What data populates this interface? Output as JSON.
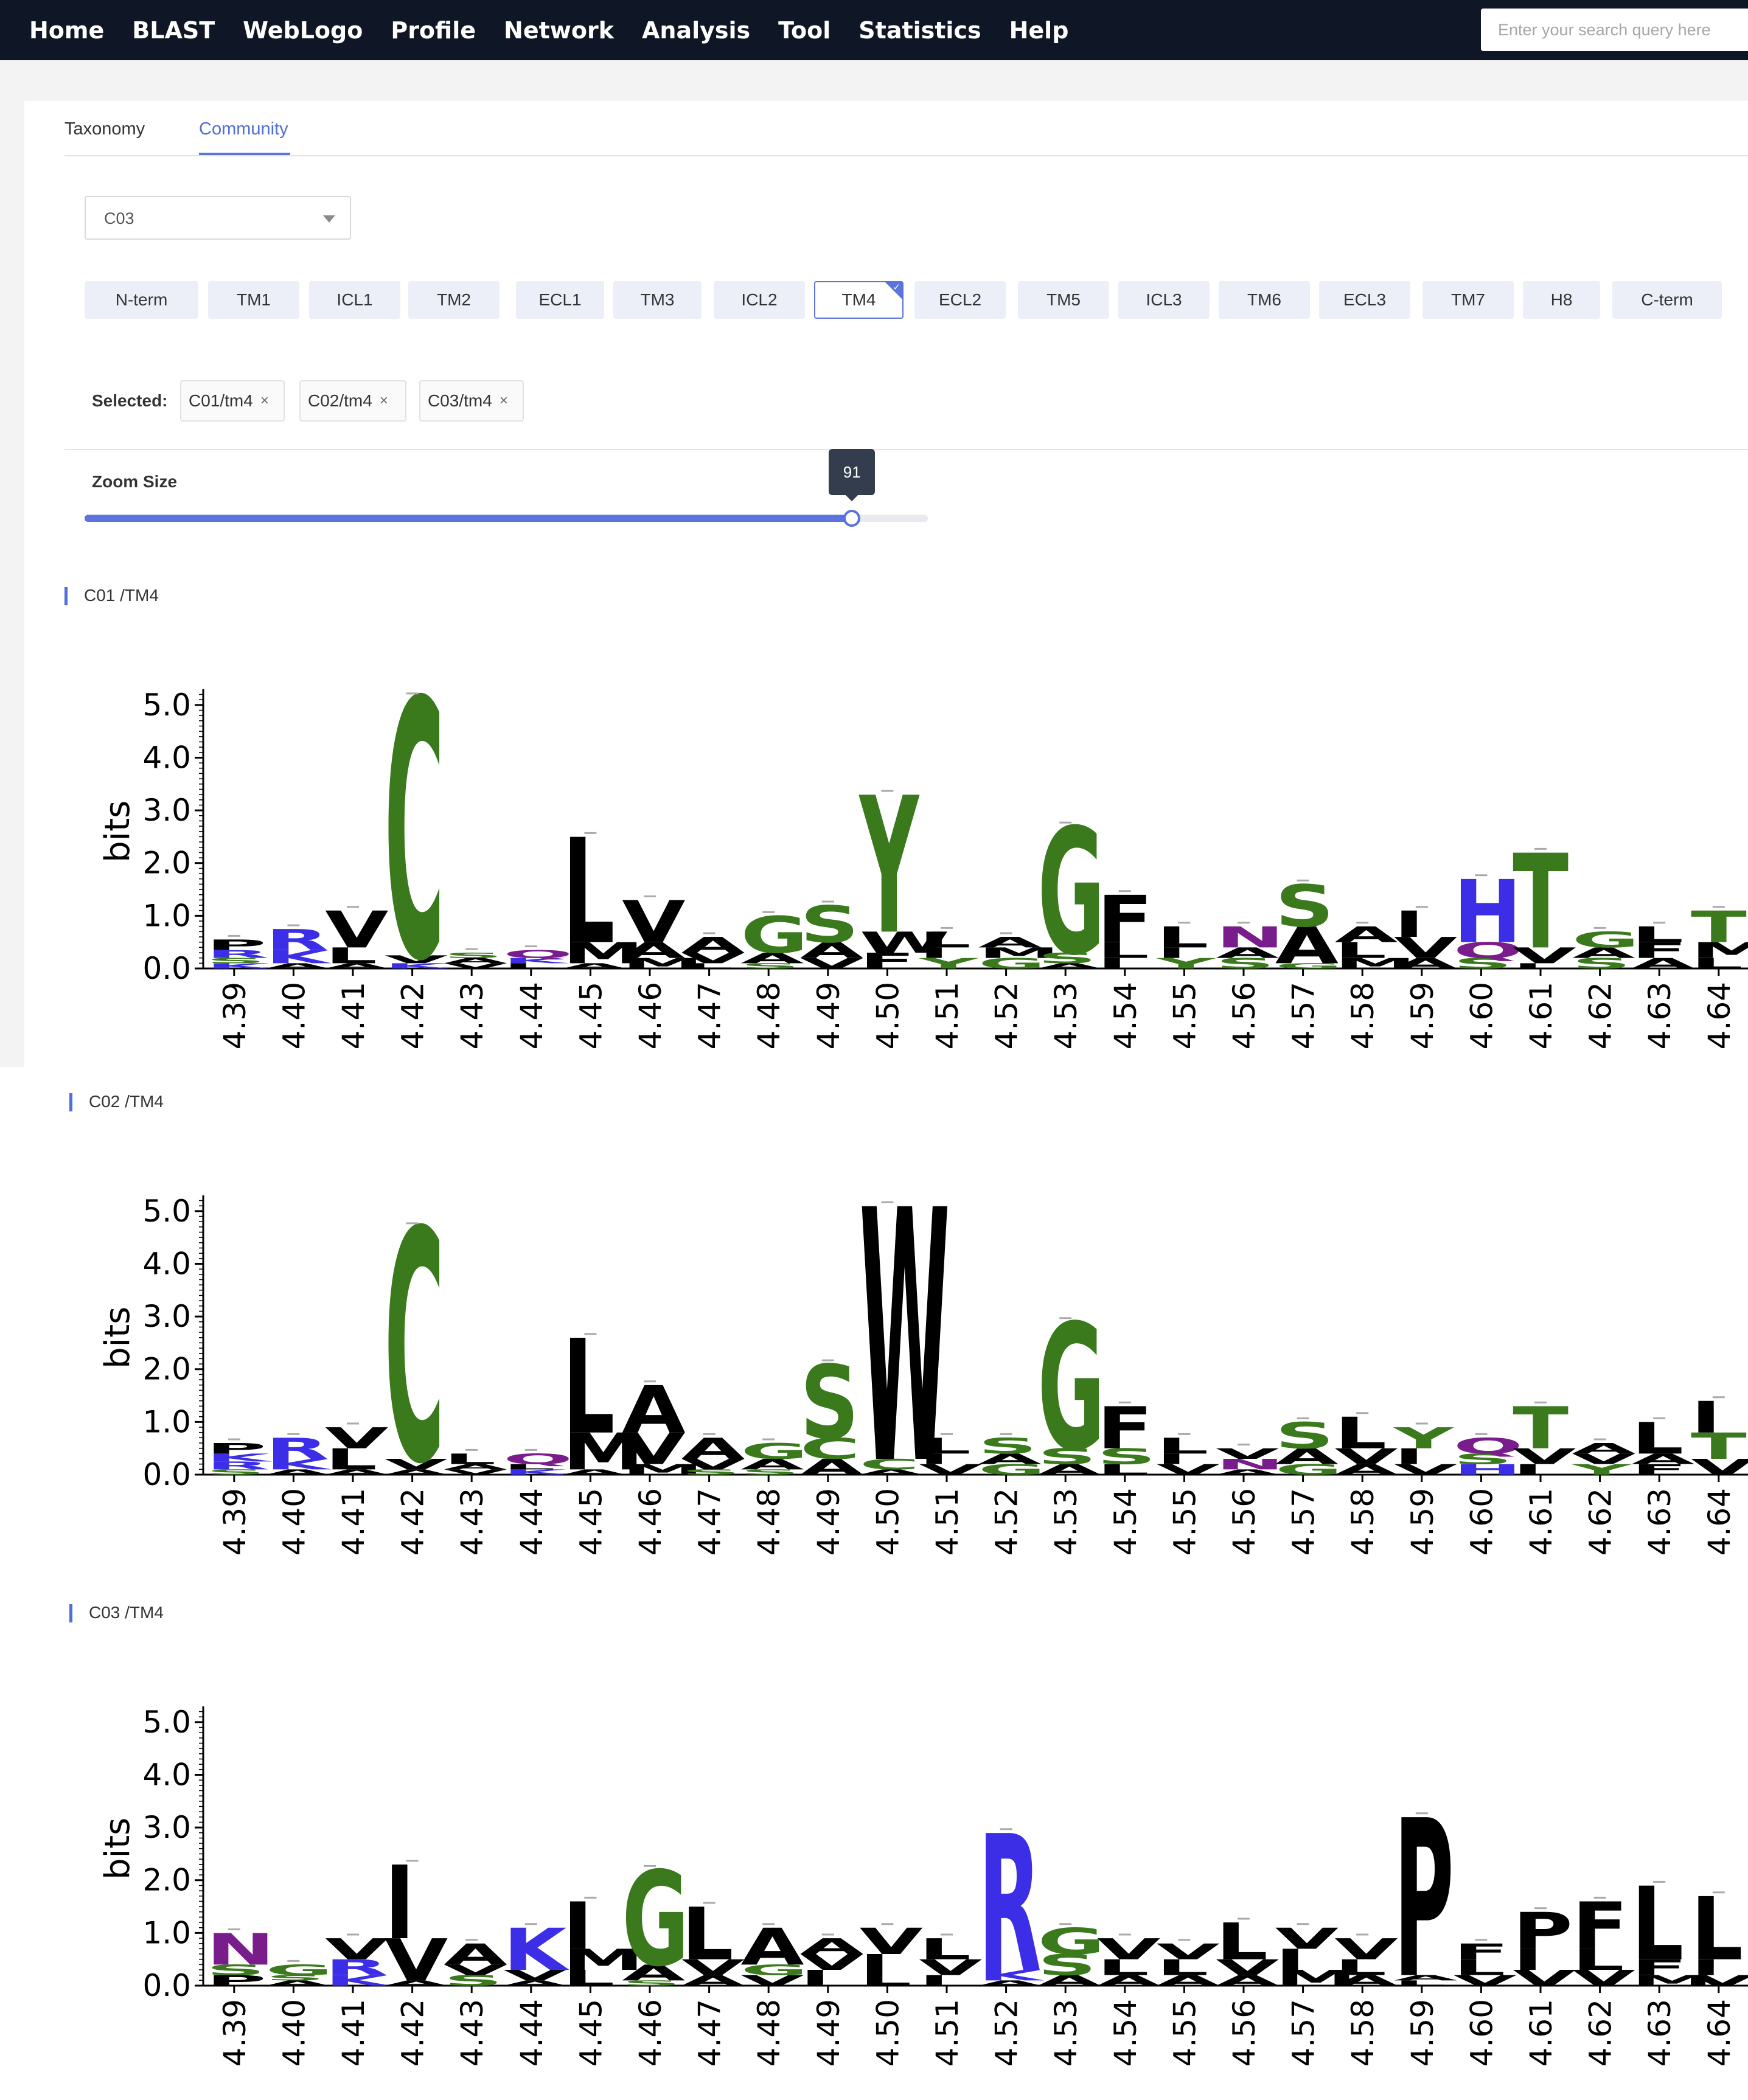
{
  "nav": {
    "items": [
      "Home",
      "BLAST",
      "WebLogo",
      "Profile",
      "Network",
      "Analysis",
      "Tool",
      "Statistics",
      "Help"
    ],
    "search_placeholder": "Enter your search query here"
  },
  "tabs": {
    "taxonomy": "Taxonomy",
    "community": "Community",
    "active": "Community"
  },
  "select": {
    "value": "C03"
  },
  "segments": {
    "items": [
      "N-term",
      "TM1",
      "ICL1",
      "TM2",
      "ECL1",
      "TM3",
      "ICL2",
      "TM4",
      "ECL2",
      "TM5",
      "ICL3",
      "TM6",
      "ECL3",
      "TM7",
      "H8",
      "C-term"
    ],
    "active": "TM4"
  },
  "selected": {
    "label": "Selected:",
    "tags": [
      "C01/tm4",
      "C02/tm4",
      "C03/tm4"
    ],
    "remove_glyph": "×"
  },
  "zoom": {
    "label": "Zoom Size",
    "value": 91,
    "min": 0,
    "max": 100
  },
  "colors": {
    "nav_bg": "#0f1726",
    "accent": "#5a73dd",
    "hydrophobic": "#000000",
    "polar": "#3a7a1c",
    "basic": "#3b2ee6",
    "acidic": "#e0201b",
    "amide": "#7a1d8c"
  },
  "chart_data": [
    {
      "type": "sequence-logo",
      "title": "C01 /TM4",
      "ylabel": "bits",
      "ylim": [
        0,
        5
      ],
      "yticks": [
        "0.0",
        "1.0",
        "2.0",
        "3.0",
        "4.0",
        "5.0"
      ],
      "positions": [
        "4.39",
        "4.40",
        "4.41",
        "4.42",
        "4.43",
        "4.44",
        "4.45",
        "4.46",
        "4.47",
        "4.48",
        "4.49",
        "4.50",
        "4.51",
        "4.52",
        "4.53",
        "4.54",
        "4.55",
        "4.56",
        "4.57",
        "4.58",
        "4.59",
        "4.60",
        "4.61",
        "4.62",
        "4.63",
        "4.64"
      ],
      "columns": [
        [
          [
            "P",
            0.2
          ],
          [
            "R",
            0.15
          ],
          [
            "K",
            0.1
          ],
          [
            "S",
            0.1
          ]
        ],
        [
          [
            "R",
            0.4
          ],
          [
            "K",
            0.25
          ],
          [
            "A",
            0.1
          ]
        ],
        [
          [
            "V",
            0.7
          ],
          [
            "L",
            0.3
          ],
          [
            "A",
            0.1
          ]
        ],
        [
          [
            "C",
            4.9
          ],
          [
            "V",
            0.15
          ],
          [
            "K",
            0.1
          ]
        ],
        [
          [
            "V",
            0.1
          ],
          [
            "A",
            0.1
          ],
          [
            "S",
            0.1
          ]
        ],
        [
          [
            "Q",
            0.15
          ],
          [
            "L",
            0.1
          ],
          [
            "K",
            0.1
          ]
        ],
        [
          [
            "L",
            2.0
          ],
          [
            "M",
            0.4
          ],
          [
            "A",
            0.1
          ]
        ],
        [
          [
            "V",
            0.8
          ],
          [
            "A",
            0.3
          ],
          [
            "M",
            0.2
          ]
        ],
        [
          [
            "A",
            0.3
          ],
          [
            "V",
            0.2
          ],
          [
            "L",
            0.1
          ]
        ],
        [
          [
            "G",
            0.7
          ],
          [
            "A",
            0.2
          ],
          [
            "S",
            0.1
          ]
        ],
        [
          [
            "S",
            0.7
          ],
          [
            "A",
            0.3
          ],
          [
            "V",
            0.2
          ]
        ],
        [
          [
            "Y",
            2.6
          ],
          [
            "W",
            0.4
          ],
          [
            "F",
            0.3
          ]
        ],
        [
          [
            "L",
            0.3
          ],
          [
            "Y",
            0.2
          ],
          [
            "I",
            0.2
          ]
        ],
        [
          [
            "G",
            0.2
          ],
          [
            "M",
            0.2
          ],
          [
            "A",
            0.2
          ]
        ],
        [
          [
            "G",
            2.4
          ],
          [
            "S",
            0.2
          ],
          [
            "A",
            0.1
          ]
        ],
        [
          [
            "F",
            0.9
          ],
          [
            "L",
            0.3
          ],
          [
            "I",
            0.2
          ]
        ],
        [
          [
            "L",
            0.4
          ],
          [
            "Y",
            0.2
          ],
          [
            "I",
            0.2
          ]
        ],
        [
          [
            "N",
            0.4
          ],
          [
            "S",
            0.2
          ],
          [
            "A",
            0.2
          ]
        ],
        [
          [
            "S",
            0.8
          ],
          [
            "A",
            0.7
          ],
          [
            "G",
            0.1
          ]
        ],
        [
          [
            "L",
            0.3
          ],
          [
            "A",
            0.3
          ],
          [
            "M",
            0.2
          ]
        ],
        [
          [
            "I",
            0.5
          ],
          [
            "V",
            0.4
          ],
          [
            "A",
            0.2
          ]
        ],
        [
          [
            "H",
            1.2
          ],
          [
            "Q",
            0.3
          ],
          [
            "S",
            0.2
          ]
        ],
        [
          [
            "T",
            1.8
          ],
          [
            "V",
            0.3
          ],
          [
            "I",
            0.1
          ]
        ],
        [
          [
            "G",
            0.3
          ],
          [
            "S",
            0.2
          ],
          [
            "A",
            0.2
          ]
        ],
        [
          [
            "F",
            0.3
          ],
          [
            "L",
            0.3
          ],
          [
            "A",
            0.2
          ]
        ],
        [
          [
            "T",
            0.6
          ],
          [
            "M",
            0.3
          ],
          [
            "L",
            0.2
          ]
        ]
      ]
    },
    {
      "type": "sequence-logo",
      "title": "C02 /TM4",
      "ylabel": "bits",
      "ylim": [
        0,
        5
      ],
      "yticks": [
        "0.0",
        "1.0",
        "2.0",
        "3.0",
        "4.0",
        "5.0"
      ],
      "positions": [
        "4.39",
        "4.40",
        "4.41",
        "4.42",
        "4.43",
        "4.44",
        "4.45",
        "4.46",
        "4.47",
        "4.48",
        "4.49",
        "4.50",
        "4.51",
        "4.52",
        "4.53",
        "4.54",
        "4.55",
        "4.56",
        "4.57",
        "4.58",
        "4.59",
        "4.60",
        "4.61",
        "4.62",
        "4.63",
        "4.64"
      ],
      "columns": [
        [
          [
            "P",
            0.2
          ],
          [
            "R",
            0.15
          ],
          [
            "K",
            0.15
          ],
          [
            "S",
            0.1
          ]
        ],
        [
          [
            "R",
            0.4
          ],
          [
            "K",
            0.2
          ],
          [
            "A",
            0.1
          ]
        ],
        [
          [
            "L",
            0.4
          ],
          [
            "V",
            0.4
          ],
          [
            "A",
            0.1
          ]
        ],
        [
          [
            "C",
            4.4
          ],
          [
            "V",
            0.2
          ],
          [
            "A",
            0.1
          ]
        ],
        [
          [
            "L",
            0.2
          ],
          [
            "V",
            0.1
          ],
          [
            "A",
            0.1
          ]
        ],
        [
          [
            "Q",
            0.2
          ],
          [
            "K",
            0.1
          ],
          [
            "L",
            0.1
          ]
        ],
        [
          [
            "L",
            1.8
          ],
          [
            "M",
            0.7
          ],
          [
            "A",
            0.1
          ]
        ],
        [
          [
            "A",
            0.9
          ],
          [
            "V",
            0.6
          ],
          [
            "M",
            0.2
          ]
        ],
        [
          [
            "A",
            0.4
          ],
          [
            "V",
            0.2
          ],
          [
            "S",
            0.1
          ]
        ],
        [
          [
            "G",
            0.3
          ],
          [
            "A",
            0.2
          ],
          [
            "S",
            0.1
          ]
        ],
        [
          [
            "S",
            1.4
          ],
          [
            "C",
            0.4
          ],
          [
            "A",
            0.3
          ]
        ],
        [
          [
            "W",
            4.8
          ],
          [
            "C",
            0.2
          ],
          [
            "A",
            0.1
          ]
        ],
        [
          [
            "L",
            0.3
          ],
          [
            "V",
            0.2
          ],
          [
            "I",
            0.2
          ]
        ],
        [
          [
            "S",
            0.3
          ],
          [
            "G",
            0.2
          ],
          [
            "A",
            0.2
          ]
        ],
        [
          [
            "G",
            2.4
          ],
          [
            "S",
            0.3
          ],
          [
            "A",
            0.2
          ]
        ],
        [
          [
            "F",
            0.8
          ],
          [
            "S",
            0.3
          ],
          [
            "L",
            0.2
          ]
        ],
        [
          [
            "L",
            0.3
          ],
          [
            "V",
            0.2
          ],
          [
            "I",
            0.2
          ]
        ],
        [
          [
            "N",
            0.2
          ],
          [
            "V",
            0.2
          ],
          [
            "A",
            0.1
          ]
        ],
        [
          [
            "S",
            0.5
          ],
          [
            "A",
            0.3
          ],
          [
            "G",
            0.2
          ]
        ],
        [
          [
            "L",
            0.6
          ],
          [
            "V",
            0.3
          ],
          [
            "A",
            0.2
          ]
        ],
        [
          [
            "Y",
            0.4
          ],
          [
            "I",
            0.3
          ],
          [
            "V",
            0.2
          ]
        ],
        [
          [
            "Q",
            0.3
          ],
          [
            "H",
            0.2
          ],
          [
            "S",
            0.2
          ]
        ],
        [
          [
            "T",
            0.8
          ],
          [
            "V",
            0.3
          ],
          [
            "I",
            0.2
          ]
        ],
        [
          [
            "Y",
            0.2
          ],
          [
            "V",
            0.2
          ],
          [
            "A",
            0.2
          ]
        ],
        [
          [
            "L",
            0.6
          ],
          [
            "F",
            0.2
          ],
          [
            "A",
            0.2
          ]
        ],
        [
          [
            "I",
            0.6
          ],
          [
            "T",
            0.5
          ],
          [
            "V",
            0.3
          ]
        ]
      ]
    },
    {
      "type": "sequence-logo",
      "title": "C03 /TM4",
      "ylabel": "bits",
      "ylim": [
        0,
        5
      ],
      "yticks": [
        "0.0",
        "1.0",
        "2.0",
        "3.0",
        "4.0",
        "5.0"
      ],
      "positions": [
        "4.39",
        "4.40",
        "4.41",
        "4.42",
        "4.43",
        "4.44",
        "4.45",
        "4.46",
        "4.47",
        "4.48",
        "4.49",
        "4.50",
        "4.51",
        "4.52",
        "4.53",
        "4.54",
        "4.55",
        "4.56",
        "4.57",
        "4.58",
        "4.59",
        "4.60",
        "4.61",
        "4.62",
        "4.63",
        "4.64"
      ],
      "columns": [
        [
          [
            "N",
            0.6
          ],
          [
            "P",
            0.2
          ],
          [
            "S",
            0.2
          ]
        ],
        [
          [
            "G",
            0.2
          ],
          [
            "A",
            0.1
          ],
          [
            "S",
            0.1
          ]
        ],
        [
          [
            "V",
            0.4
          ],
          [
            "R",
            0.3
          ],
          [
            "K",
            0.2
          ]
        ],
        [
          [
            "I",
            1.4
          ],
          [
            "V",
            0.8
          ],
          [
            "A",
            0.1
          ]
        ],
        [
          [
            "A",
            0.4
          ],
          [
            "S",
            0.2
          ],
          [
            "V",
            0.2
          ]
        ],
        [
          [
            "K",
            0.8
          ],
          [
            "V",
            0.2
          ],
          [
            "A",
            0.1
          ]
        ],
        [
          [
            "I",
            0.9
          ],
          [
            "M",
            0.4
          ],
          [
            "L",
            0.3
          ]
        ],
        [
          [
            "G",
            1.8
          ],
          [
            "A",
            0.3
          ],
          [
            "S",
            0.1
          ]
        ],
        [
          [
            "L",
            1.0
          ],
          [
            "V",
            0.3
          ],
          [
            "A",
            0.2
          ]
        ],
        [
          [
            "A",
            0.7
          ],
          [
            "V",
            0.2
          ],
          [
            "G",
            0.2
          ]
        ],
        [
          [
            "I",
            0.3
          ],
          [
            "V",
            0.3
          ],
          [
            "A",
            0.3
          ]
        ],
        [
          [
            "V",
            0.5
          ],
          [
            "L",
            0.3
          ],
          [
            "I",
            0.3
          ]
        ],
        [
          [
            "L",
            0.4
          ],
          [
            "V",
            0.3
          ],
          [
            "I",
            0.2
          ]
        ],
        [
          [
            "R",
            2.6
          ],
          [
            "K",
            0.2
          ],
          [
            "A",
            0.1
          ]
        ],
        [
          [
            "G",
            0.5
          ],
          [
            "S",
            0.4
          ],
          [
            "A",
            0.2
          ]
        ],
        [
          [
            "V",
            0.4
          ],
          [
            "L",
            0.3
          ],
          [
            "A",
            0.2
          ]
        ],
        [
          [
            "L",
            0.3
          ],
          [
            "V",
            0.3
          ],
          [
            "A",
            0.2
          ]
        ],
        [
          [
            "L",
            0.7
          ],
          [
            "V",
            0.3
          ],
          [
            "A",
            0.2
          ]
        ],
        [
          [
            "I",
            0.4
          ],
          [
            "V",
            0.4
          ],
          [
            "M",
            0.3
          ]
        ],
        [
          [
            "V",
            0.4
          ],
          [
            "L",
            0.3
          ],
          [
            "A",
            0.2
          ]
        ],
        [
          [
            "P",
            3.0
          ],
          [
            "L",
            0.1
          ],
          [
            "A",
            0.1
          ]
        ],
        [
          [
            "L",
            0.3
          ],
          [
            "F",
            0.3
          ],
          [
            "V",
            0.2
          ]
        ],
        [
          [
            "P",
            0.7
          ],
          [
            "I",
            0.4
          ],
          [
            "V",
            0.3
          ]
        ],
        [
          [
            "F",
            0.9
          ],
          [
            "L",
            0.4
          ],
          [
            "V",
            0.3
          ]
        ],
        [
          [
            "L",
            1.4
          ],
          [
            "F",
            0.3
          ],
          [
            "M",
            0.2
          ]
        ],
        [
          [
            "L",
            1.2
          ],
          [
            "I",
            0.3
          ],
          [
            "V",
            0.2
          ]
        ]
      ]
    }
  ]
}
